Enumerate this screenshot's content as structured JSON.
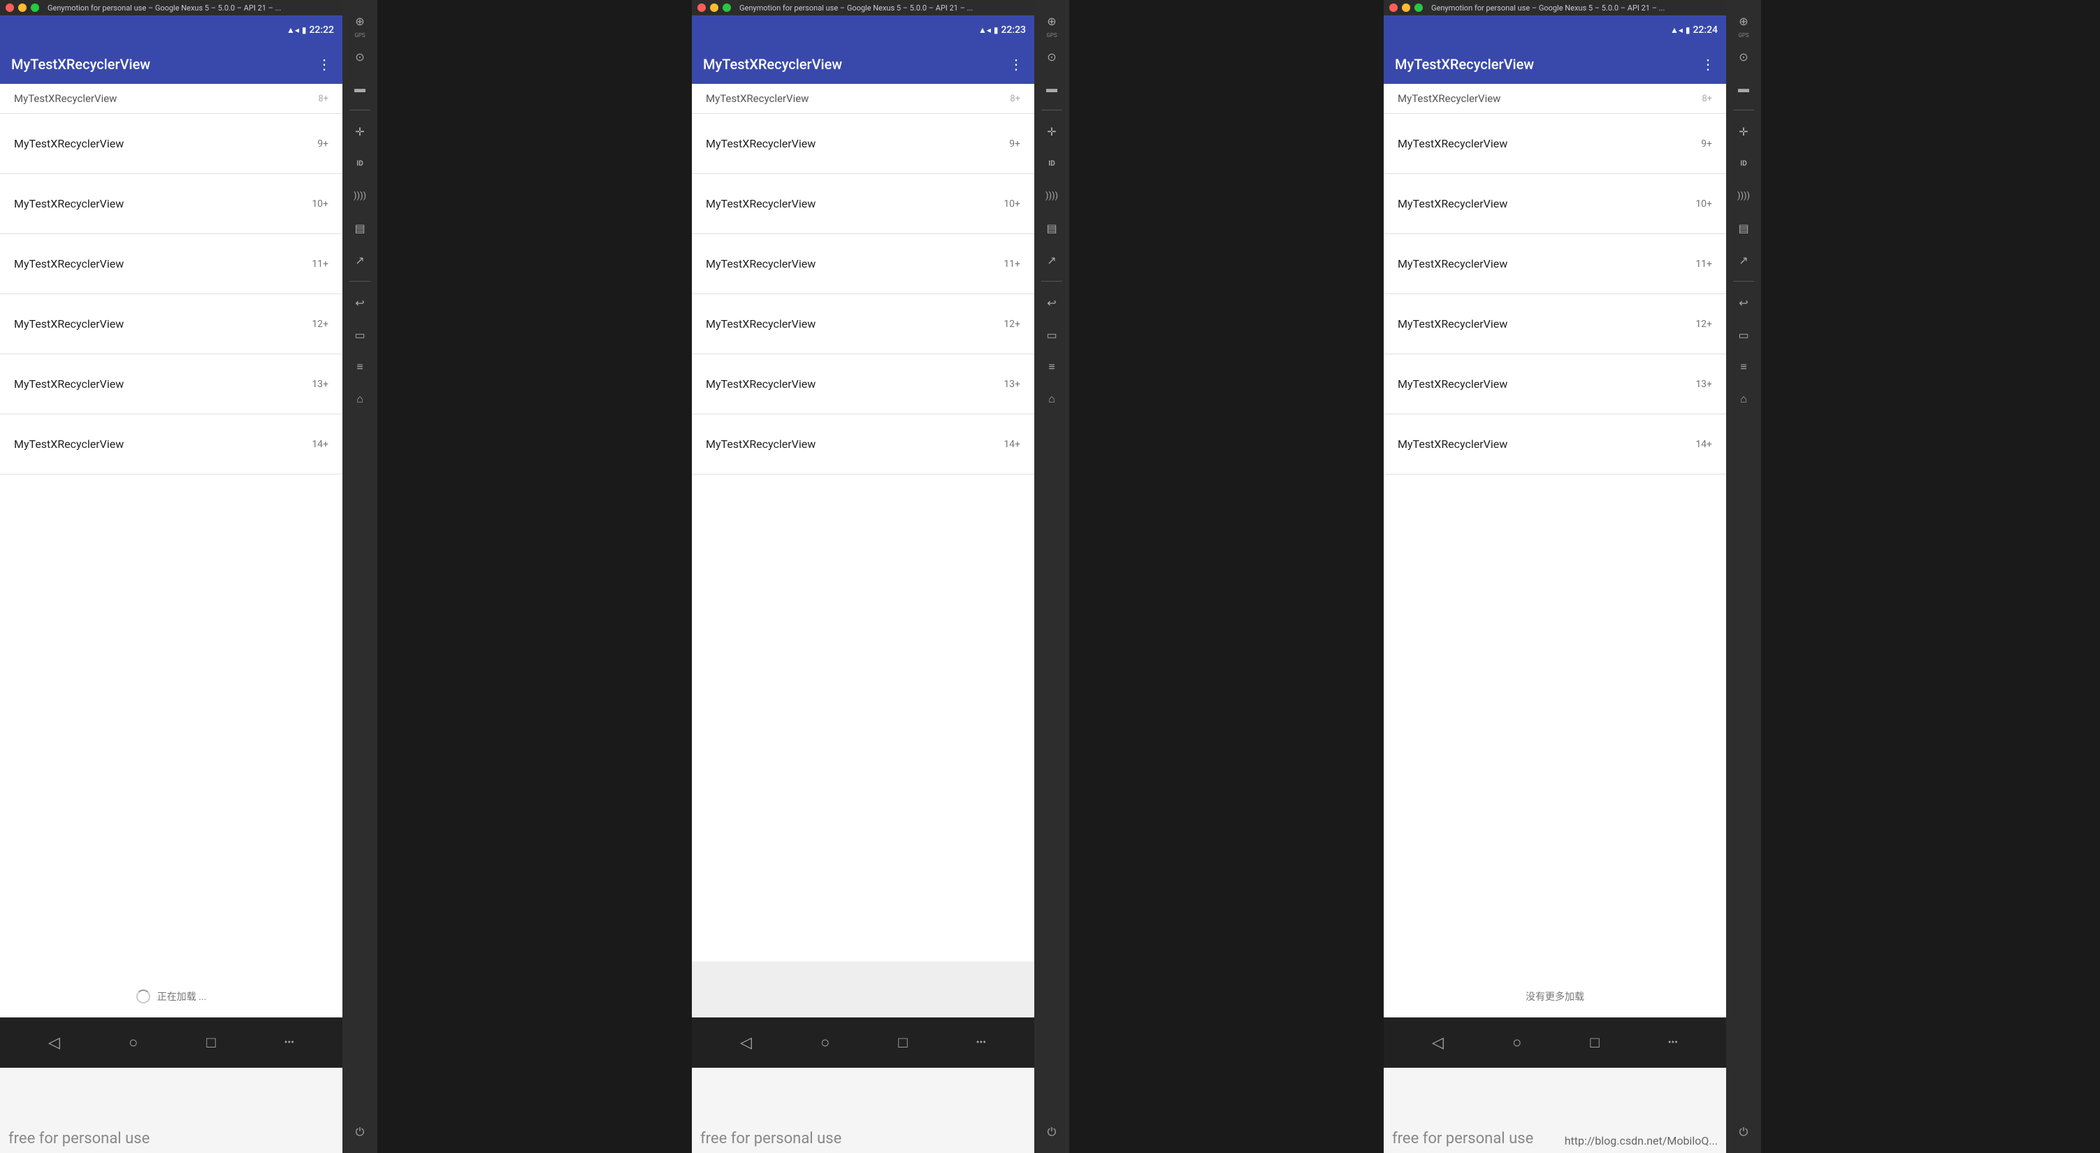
{
  "windows": [
    {
      "id": "window1",
      "titleBar": {
        "title": "Genymotion for personal use – Google Nexus 5 – 5.0.0 – API 21 – ...",
        "dots": [
          "red",
          "yellow",
          "green"
        ]
      },
      "statusBar": {
        "time": "22:22",
        "batteryIcon": "🔋",
        "signalIcon": "▲"
      },
      "appTitle": "MyTestXRecyclerView",
      "menuIcon": "⋮",
      "listItems": [
        {
          "text": "MyTestXRecyclerView",
          "badge": "9+"
        },
        {
          "text": "MyTestXRecyclerView",
          "badge": "10+"
        },
        {
          "text": "MyTestXRecyclerView",
          "badge": "11+"
        },
        {
          "text": "MyTestXRecyclerView",
          "badge": "12+"
        },
        {
          "text": "MyTestXRecyclerView",
          "badge": "13+"
        },
        {
          "text": "MyTestXRecyclerView",
          "badge": "14+"
        }
      ],
      "partialItem": {
        "text": "MyTestXRecyclerView",
        "badge": "8+"
      },
      "footer": {
        "type": "loading",
        "text": "正在加载 ..."
      },
      "bottomNav": {
        "back": "◁",
        "home": "○",
        "recents": "□",
        "more": "•••"
      },
      "watermark": "free for personal use"
    },
    {
      "id": "window2",
      "titleBar": {
        "title": "Genymotion for personal use – Google Nexus 5 – 5.0.0 – API 21 – ...",
        "dots": [
          "red",
          "yellow",
          "green"
        ]
      },
      "statusBar": {
        "time": "22:23",
        "batteryIcon": "🔋",
        "signalIcon": "▲"
      },
      "appTitle": "MyTestXRecyclerView",
      "menuIcon": "⋮",
      "listItems": [
        {
          "text": "MyTestXRecyclerView",
          "badge": "9+"
        },
        {
          "text": "MyTestXRecyclerView",
          "badge": "10+"
        },
        {
          "text": "MyTestXRecyclerView",
          "badge": "11+"
        },
        {
          "text": "MyTestXRecyclerView",
          "badge": "12+"
        },
        {
          "text": "MyTestXRecyclerView",
          "badge": "13+"
        },
        {
          "text": "MyTestXRecyclerView",
          "badge": "14+"
        }
      ],
      "partialItem": {
        "text": "MyTestXRecyclerView",
        "badge": "8+"
      },
      "footer": {
        "type": "placeholder",
        "text": ""
      },
      "bottomNav": {
        "back": "◁",
        "home": "○",
        "recents": "□",
        "more": "•••"
      },
      "watermark": "free for personal use"
    },
    {
      "id": "window3",
      "titleBar": {
        "title": "Genymotion for personal use – Google Nexus 5 – 5.0.0 – API 21 – ...",
        "dots": [
          "red",
          "yellow",
          "green"
        ]
      },
      "statusBar": {
        "time": "22:24",
        "batteryIcon": "🔋",
        "signalIcon": "▲"
      },
      "appTitle": "MyTestXRecyclerView",
      "menuIcon": "⋮",
      "listItems": [
        {
          "text": "MyTestXRecyclerView",
          "badge": "9+"
        },
        {
          "text": "MyTestXRecyclerView",
          "badge": "10+"
        },
        {
          "text": "MyTestXRecyclerView",
          "badge": "11+"
        },
        {
          "text": "MyTestXRecyclerView",
          "badge": "12+"
        },
        {
          "text": "MyTestXRecyclerView",
          "badge": "13+"
        },
        {
          "text": "MyTestXRecyclerView",
          "badge": "14+"
        }
      ],
      "partialItem": {
        "text": "MyTestXRecyclerView",
        "badge": "8+"
      },
      "footer": {
        "type": "nomore",
        "text": "没有更多加载"
      },
      "bottomNav": {
        "back": "◁",
        "home": "○",
        "recents": "□",
        "more": "•••"
      },
      "watermark": "free for personal use",
      "rightInfo": "http://blog.csdn.net/MobiloQ..."
    }
  ],
  "sidebar": {
    "icons": [
      {
        "name": "gps-icon",
        "label": "GPS",
        "symbol": "⊕"
      },
      {
        "name": "camera-icon",
        "label": "",
        "symbol": "⊙"
      },
      {
        "name": "video-icon",
        "label": "",
        "symbol": "▬"
      },
      {
        "name": "move-icon",
        "label": "",
        "symbol": "✛"
      },
      {
        "name": "id-icon",
        "label": "ID",
        "symbol": "ID"
      },
      {
        "name": "wifi-icon",
        "label": "",
        "symbol": "))) "
      },
      {
        "name": "message-icon",
        "label": "",
        "symbol": "▤"
      },
      {
        "name": "share-icon",
        "label": "",
        "symbol": "↗"
      },
      {
        "name": "back-nav-icon",
        "label": "",
        "symbol": "↩"
      },
      {
        "name": "recents-nav-icon",
        "label": "",
        "symbol": "▭"
      },
      {
        "name": "menu-nav-icon",
        "label": "",
        "symbol": "≡"
      },
      {
        "name": "home-nav-icon",
        "label": "",
        "symbol": "⌂"
      },
      {
        "name": "power-icon",
        "label": "",
        "symbol": "⏻"
      }
    ]
  }
}
